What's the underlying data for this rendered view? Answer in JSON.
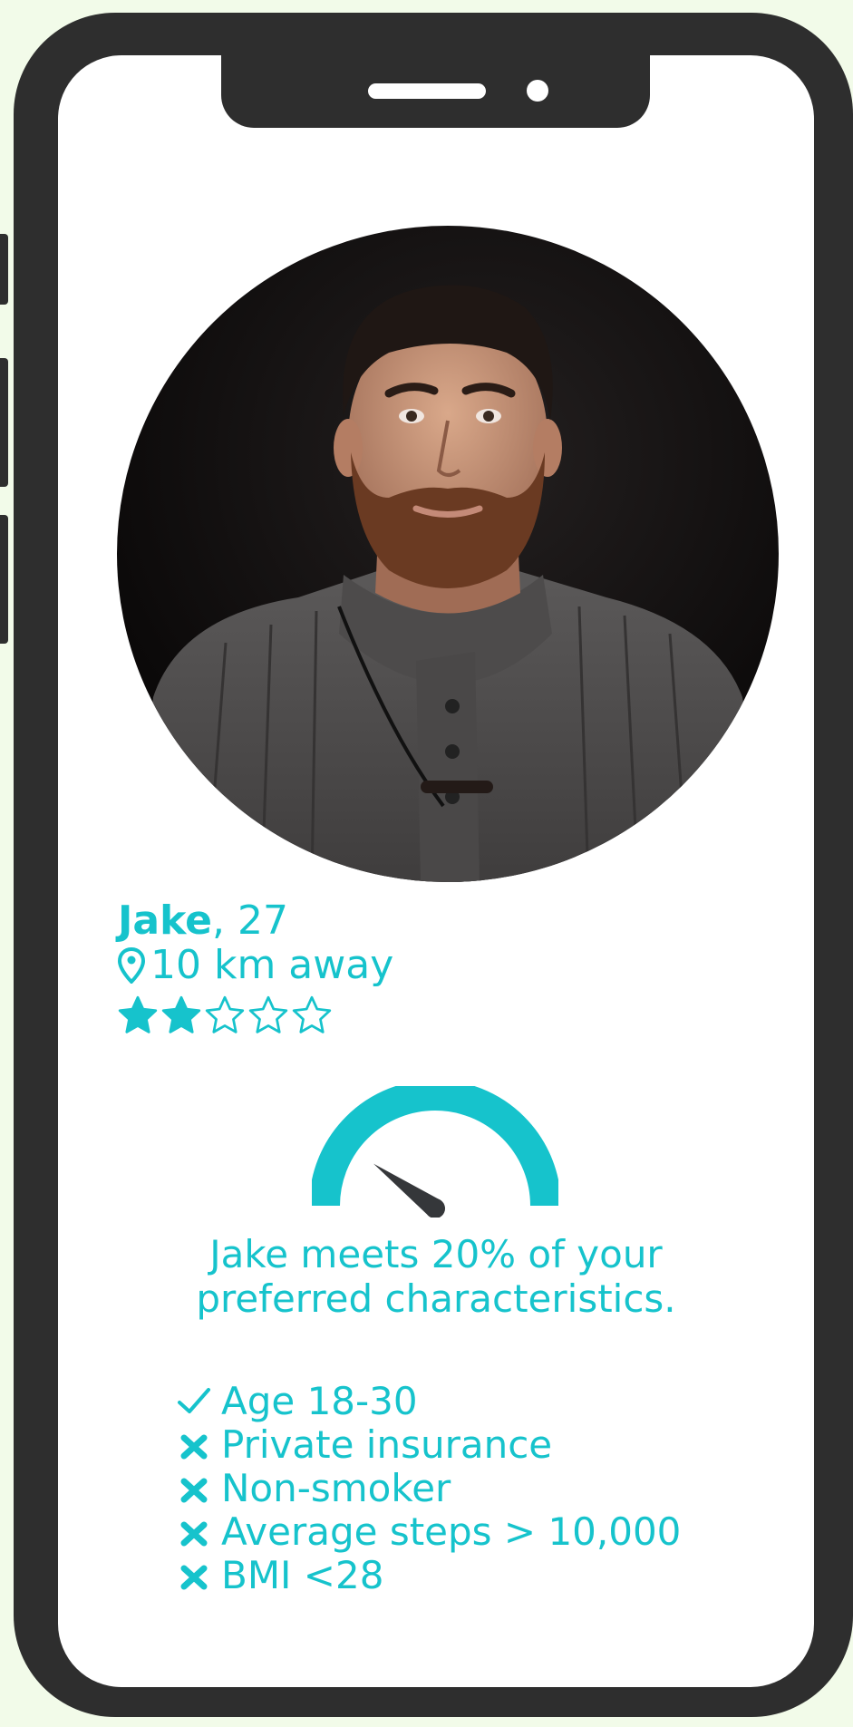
{
  "profile": {
    "name": "Jake",
    "age_suffix": ", 27",
    "distance": "10 km away",
    "rating": 2,
    "rating_max": 5
  },
  "match": {
    "percent": 20,
    "summary_line1": "Jake meets 20% of your",
    "summary_line2": "preferred characteristics."
  },
  "criteria": [
    {
      "label": "Age 18-30",
      "met": true
    },
    {
      "label": "Private insurance",
      "met": false
    },
    {
      "label": "Non-smoker",
      "met": false
    },
    {
      "label": "Average steps > 10,000",
      "met": false
    },
    {
      "label": "BMI <28",
      "met": false
    }
  ],
  "colors": {
    "accent": "#16c3cc",
    "frame": "#2e2e2e",
    "background": "#f2fbe9",
    "screen": "#ffffff"
  },
  "icons": {
    "location": "location-pin-icon",
    "star": "star-icon",
    "check": "check-icon",
    "cross": "cross-icon"
  }
}
